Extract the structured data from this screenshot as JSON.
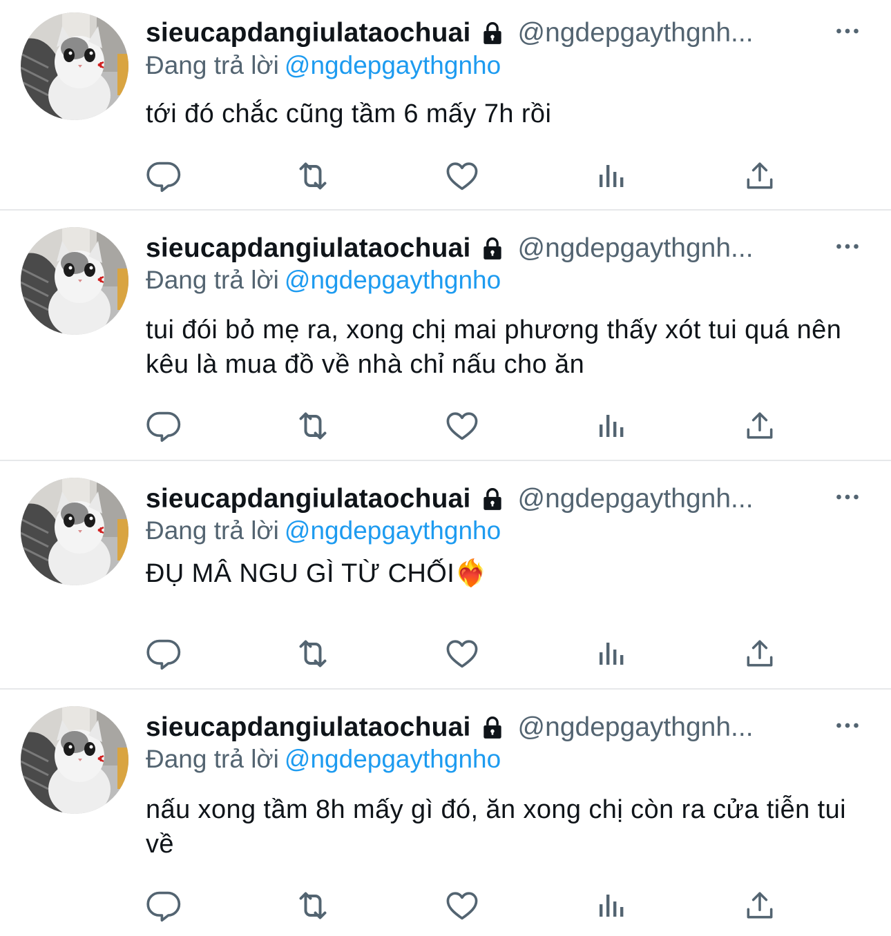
{
  "colors": {
    "accent": "#1d9bf0",
    "secondary_text": "#536471",
    "icon": "#536471",
    "divider": "#e6e8ea"
  },
  "tweets": [
    {
      "display_name": "sieucapdangiulataochuai",
      "handle": "@ngdepgaythgnh...",
      "reply_prefix": "Đang trả lời",
      "reply_to": "@ngdepgaythgnho",
      "text": "tới đó chắc cũng tầm 6 mấy 7h rồi"
    },
    {
      "display_name": "sieucapdangiulataochuai",
      "handle": "@ngdepgaythgnh...",
      "reply_prefix": "Đang trả lời",
      "reply_to": "@ngdepgaythgnho",
      "text": "tui đói bỏ mẹ ra, xong chị mai phương thấy xót tui quá nên kêu là mua đồ về nhà chỉ nấu cho ăn"
    },
    {
      "display_name": "sieucapdangiulataochuai",
      "handle": "@ngdepgaythgnh...",
      "reply_prefix": "Đang trả lời",
      "reply_to": "@ngdepgaythgnho",
      "text": "ĐỤ MÂ NGU GÌ TỪ CHỐI❤️‍🔥"
    },
    {
      "display_name": "sieucapdangiulataochuai",
      "handle": "@ngdepgaythgnh...",
      "reply_prefix": "Đang trả lời",
      "reply_to": "@ngdepgaythgnho",
      "text": "nấu xong tầm 8h mấy gì đó, ăn xong chị còn ra cửa tiễn tui về"
    }
  ],
  "icons": {
    "protected": "lock-icon",
    "more": "more-dots-icon",
    "reply": "reply-icon",
    "retweet": "retweet-icon",
    "like": "heart-icon",
    "views": "views-chart-icon",
    "share": "share-icon"
  }
}
